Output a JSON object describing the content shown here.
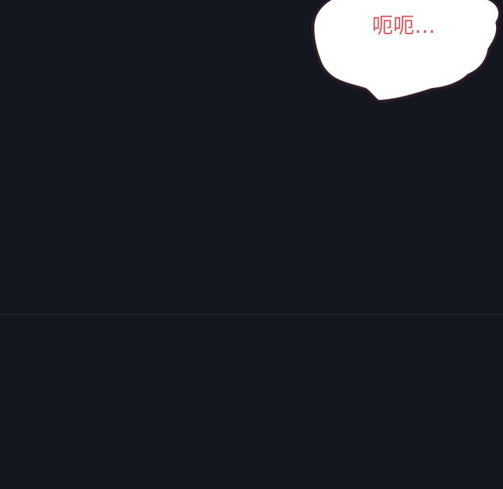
{
  "speech_bubble": {
    "text": "呃呃..."
  },
  "colors": {
    "background": "#141720",
    "bubble_fill": "#ffffff",
    "bubble_glow": "#b2454d",
    "text_color": "#d9555a",
    "divider": "#2a2d36"
  }
}
